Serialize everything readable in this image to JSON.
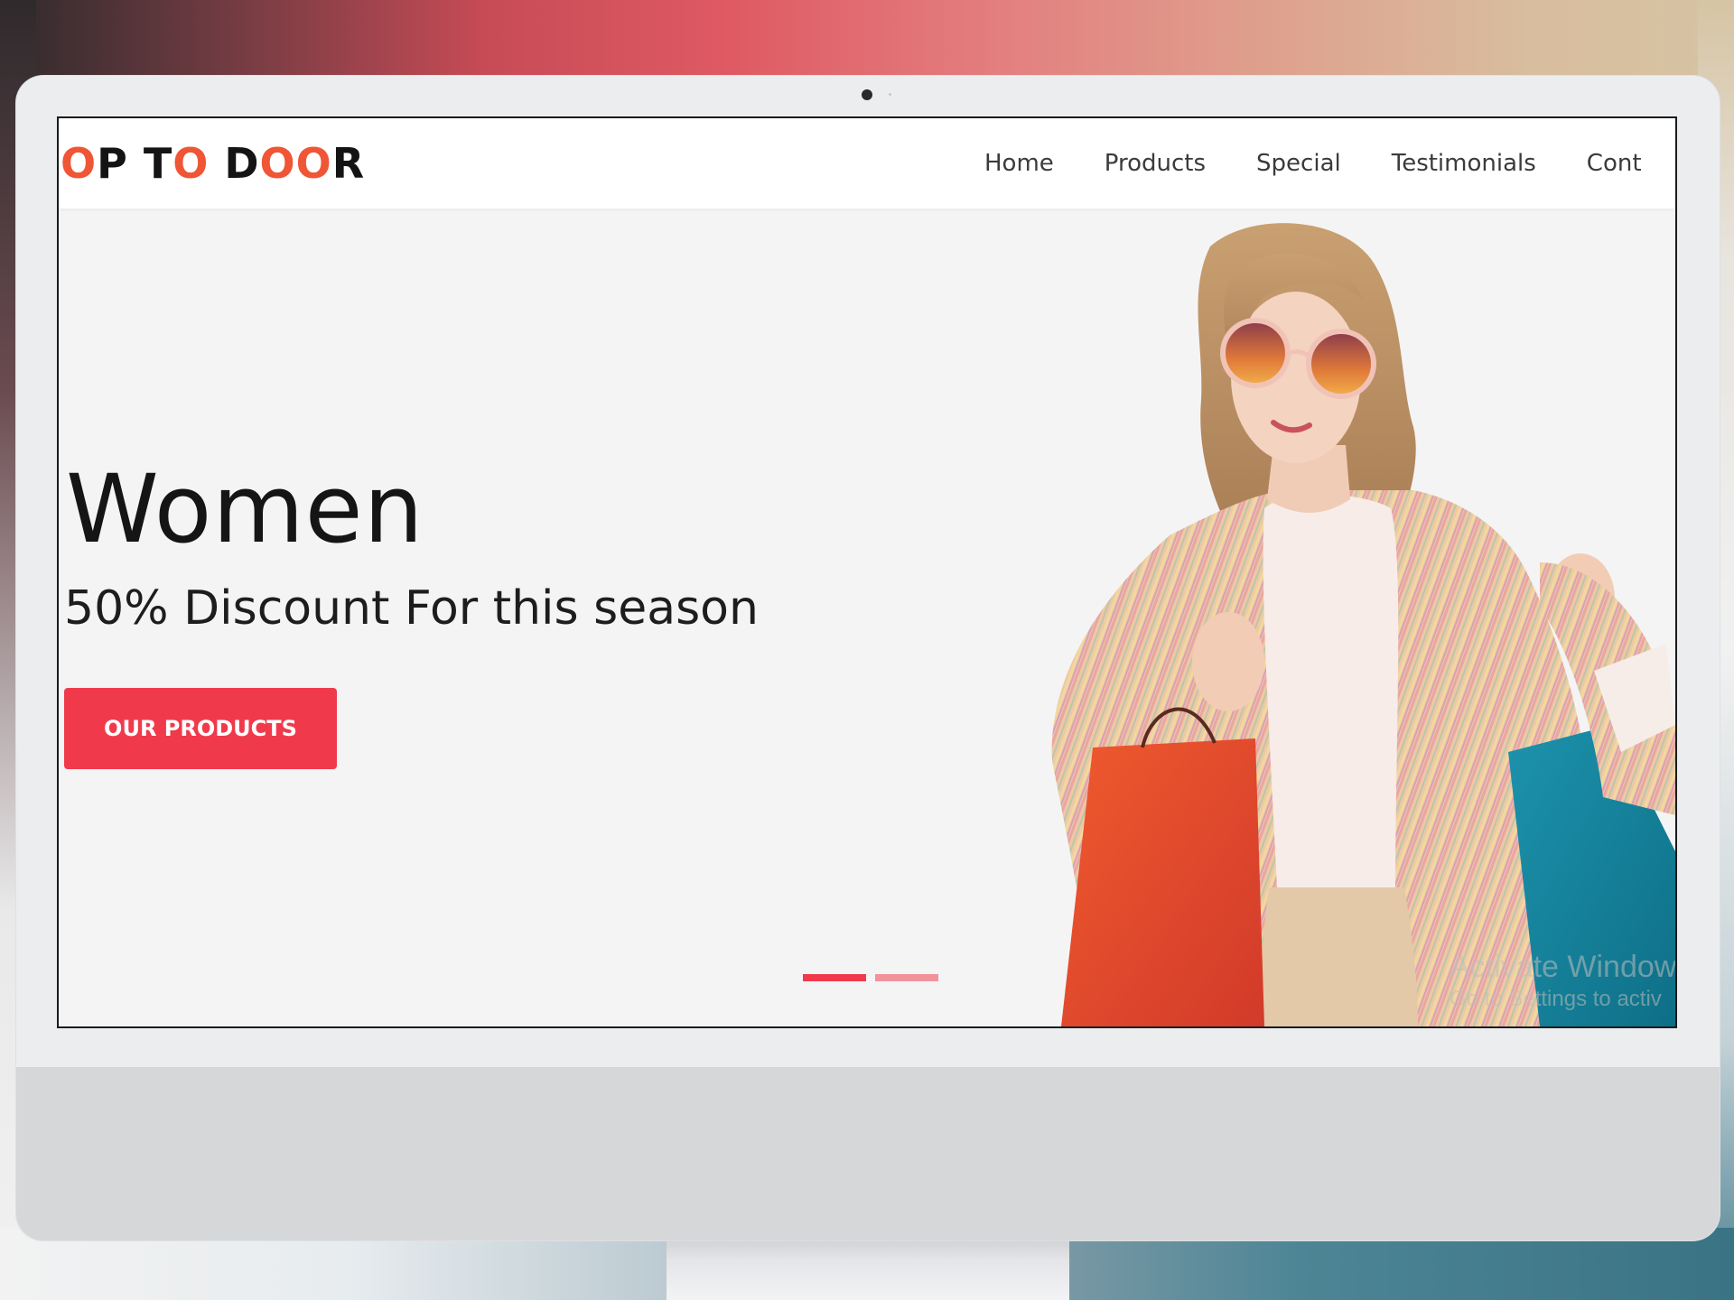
{
  "site": {
    "logo": {
      "parts": [
        {
          "text": "O",
          "accent": true
        },
        {
          "text": "P T",
          "accent": false
        },
        {
          "text": "O",
          "accent": true
        },
        {
          "text": " D",
          "accent": false
        },
        {
          "text": "OO",
          "accent": true
        },
        {
          "text": "R",
          "accent": false
        }
      ]
    },
    "nav": [
      "Home",
      "Products",
      "Special",
      "Testimonials",
      "Cont"
    ]
  },
  "hero": {
    "title": "Women",
    "subtitle": "50% Discount For this season",
    "cta_label": "OUR PRODUCTS",
    "slides": [
      {
        "active": true
      },
      {
        "active": false
      }
    ]
  },
  "watermark": {
    "line1": "Activate Window",
    "line2": "Go to Settings to activ"
  },
  "colors": {
    "accent": "#f03a4c",
    "logo_accent": "#f05535",
    "text_dark": "#151515",
    "hero_bg": "#f4f4f4"
  }
}
